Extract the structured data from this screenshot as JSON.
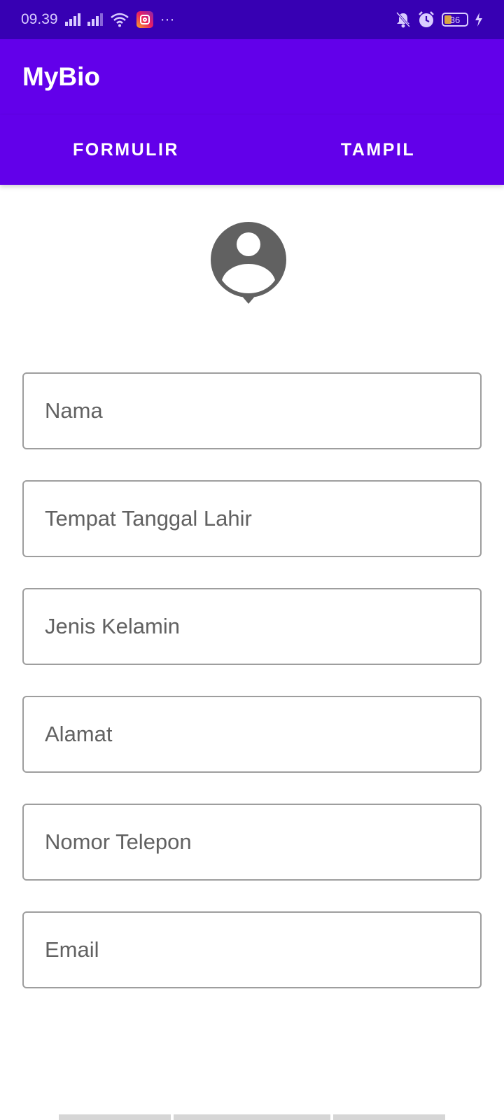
{
  "status_bar": {
    "time": "09.39",
    "notification_icons": [
      "signal-icon",
      "signal-icon",
      "wifi-icon",
      "instagram-icon"
    ],
    "more_indicator": "···",
    "battery_level": "36",
    "right_icons": [
      "bell-off-icon",
      "alarm-icon",
      "battery-icon",
      "charging-icon"
    ]
  },
  "app_bar": {
    "title": "MyBio"
  },
  "tabs": [
    {
      "label": "FORMULIR"
    },
    {
      "label": "TAMPIL"
    }
  ],
  "avatar": {
    "icon": "person-pin-icon",
    "color": "#616161"
  },
  "form": {
    "fields": [
      {
        "placeholder": "Nama",
        "value": ""
      },
      {
        "placeholder": "Tempat Tanggal Lahir",
        "value": ""
      },
      {
        "placeholder": "Jenis Kelamin",
        "value": ""
      },
      {
        "placeholder": "Alamat",
        "value": ""
      },
      {
        "placeholder": "Nomor Telepon",
        "value": ""
      },
      {
        "placeholder": "Email",
        "value": ""
      }
    ]
  },
  "colors": {
    "status_bar": "#3700b3",
    "primary": "#6200ea",
    "field_border": "#9e9e9e",
    "placeholder": "#616161"
  }
}
